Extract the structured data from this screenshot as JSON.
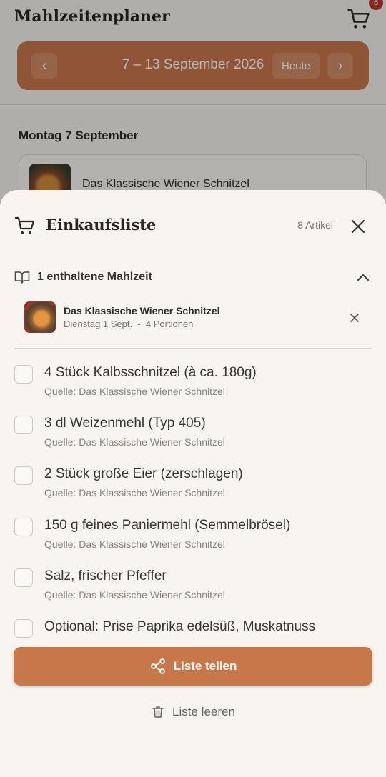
{
  "app": {
    "title": "Mahlzeitenplaner",
    "cart_badge": "6"
  },
  "week": {
    "label": "7 – 13 September 2026",
    "today_label": "Heute",
    "prev_icon": "chevron-left-icon",
    "next_icon": "chevron-right-icon"
  },
  "schedule": {
    "day_heading": "Montag 7 September",
    "card_title": "Das Klassische Wiener Schnitzel"
  },
  "sheet": {
    "title": "Einkaufsliste",
    "item_count": "8 Artikel",
    "meals_heading": "1 enthaltene Mahlzeit",
    "meal": {
      "name": "Das Klassische Wiener Schnitzel",
      "meta": "Dienstag 1 Sept.  -  4 Portionen"
    },
    "ingredients": [
      {
        "name": "4 Stück Kalbsschnitzel (à ca. 180g)",
        "source": "Quelle: Das Klassische Wiener Schnitzel"
      },
      {
        "name": "3 dl Weizenmehl (Typ 405)",
        "source": "Quelle: Das Klassische Wiener Schnitzel"
      },
      {
        "name": "2 Stück große Eier (zerschlagen)",
        "source": "Quelle: Das Klassische Wiener Schnitzel"
      },
      {
        "name": "150 g feines Paniermehl (Semmelbrösel)",
        "source": "Quelle: Das Klassische Wiener Schnitzel"
      },
      {
        "name": "Salz, frischer Pfeffer",
        "source": "Quelle: Das Klassische Wiener Schnitzel"
      },
      {
        "name": "Optional: Prise Paprika edelsüß, Muskatnuss",
        "source": ""
      }
    ],
    "share_label": "Liste teilen",
    "clear_label": "Liste leeren"
  },
  "colors": {
    "accent": "#c8774b",
    "background": "#f4f1ec",
    "sheet": "#f8f5f0",
    "badge": "#b83a2c"
  }
}
